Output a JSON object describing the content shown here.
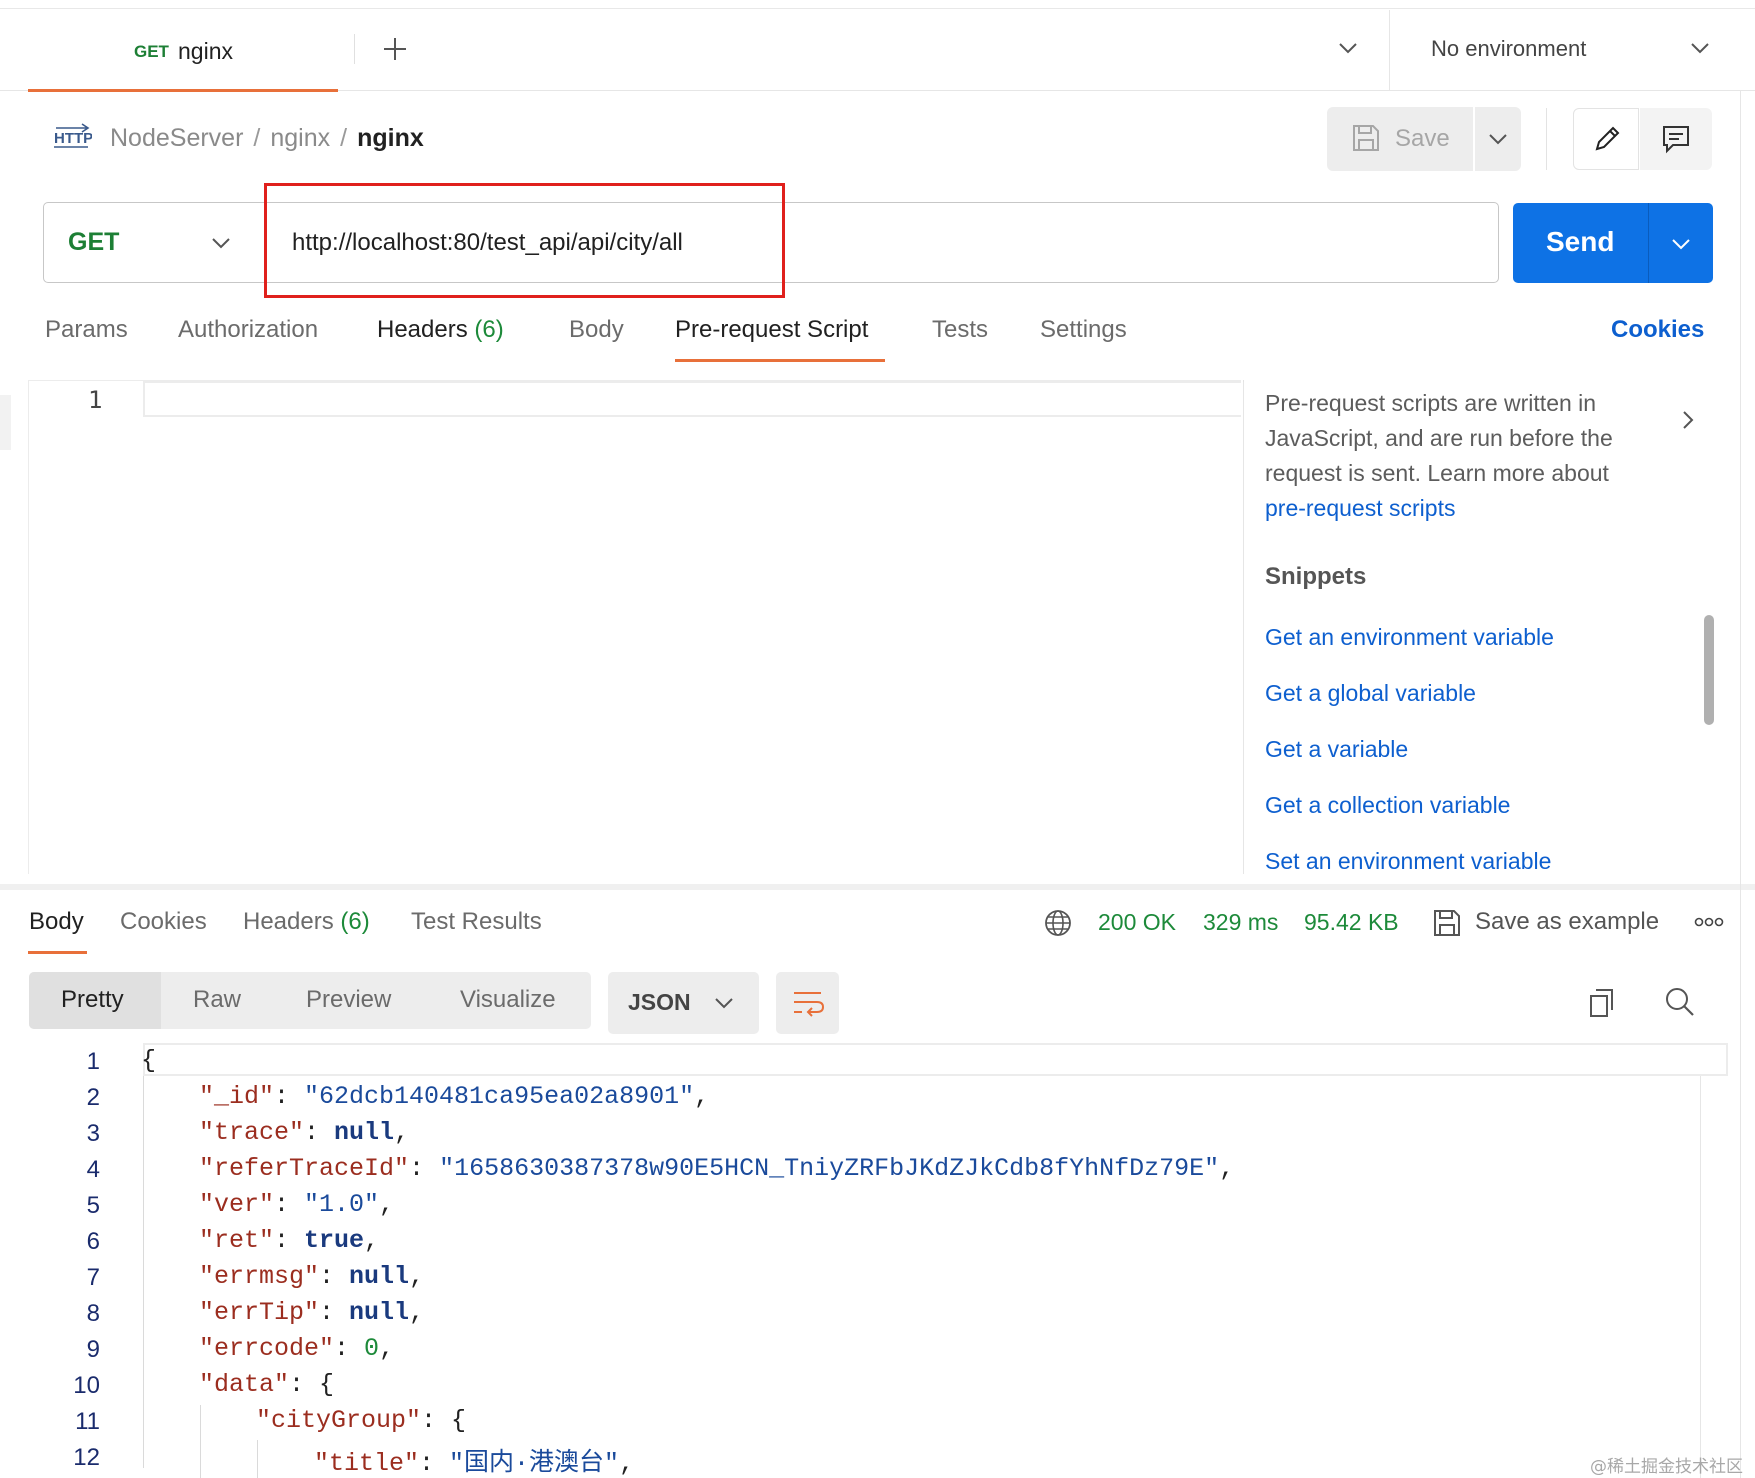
{
  "tab": {
    "method": "GET",
    "name": "nginx"
  },
  "environment": {
    "label": "No environment"
  },
  "breadcrumb": {
    "collection": "NodeServer",
    "folder": "nginx",
    "request": "nginx",
    "separator": "/"
  },
  "toolbar": {
    "save_label": "Save"
  },
  "request": {
    "method": "GET",
    "url": "http://localhost:80/test_api/api/city/all",
    "send_label": "Send"
  },
  "request_tabs": [
    {
      "label": "Params"
    },
    {
      "label": "Authorization"
    },
    {
      "label": "Headers",
      "count": "(6)"
    },
    {
      "label": "Body"
    },
    {
      "label": "Pre-request Script",
      "active": true
    },
    {
      "label": "Tests"
    },
    {
      "label": "Settings"
    }
  ],
  "cookies_label": "Cookies",
  "script_editor": {
    "line_number": "1"
  },
  "info_panel": {
    "text": "Pre-request scripts are written in JavaScript, and are run before the request is sent. Learn more about",
    "link": "pre-request scripts",
    "snippets_title": "Snippets",
    "snippets": [
      "Get an environment variable",
      "Get a global variable",
      "Get a variable",
      "Get a collection variable",
      "Set an environment variable"
    ]
  },
  "response_tabs": [
    {
      "label": "Body",
      "active": true
    },
    {
      "label": "Cookies"
    },
    {
      "label": "Headers",
      "count": "(6)"
    },
    {
      "label": "Test Results"
    }
  ],
  "response_status": {
    "status": "200 OK",
    "time": "329 ms",
    "size": "95.42 KB",
    "save_example": "Save as example"
  },
  "view_modes": [
    "Pretty",
    "Raw",
    "Preview",
    "Visualize"
  ],
  "format": "JSON",
  "code_lines": [
    "1",
    "2",
    "3",
    "4",
    "5",
    "6",
    "7",
    "8",
    "9",
    "10",
    "11",
    "12"
  ],
  "json": {
    "id_key": "\"_id\"",
    "id_val": "\"62dcb140481ca95ea02a8901\"",
    "trace_key": "\"trace\"",
    "null": "null",
    "refer_key": "\"referTraceId\"",
    "refer_val": "\"1658630387378w90E5HCN_TniyZRFbJKdZJkCdb8fYhNfDz79E\"",
    "ver_key": "\"ver\"",
    "ver_val": "\"1.0\"",
    "ret_key": "\"ret\"",
    "true": "true",
    "errmsg_key": "\"errmsg\"",
    "errtip_key": "\"errTip\"",
    "errcode_key": "\"errcode\"",
    "zero": "0",
    "data_key": "\"data\"",
    "citygroup_key": "\"cityGroup\"",
    "title_key": "\"title\"",
    "title_val": "\"国内·港澳台\""
  },
  "watermark": "@稀土掘金技术社区",
  "colors": {
    "accent": "#e8703a",
    "primary": "#0e72e5",
    "method_green": "#1d7f35",
    "highlight_red": "#e0201c",
    "link": "#0d5fcf"
  }
}
